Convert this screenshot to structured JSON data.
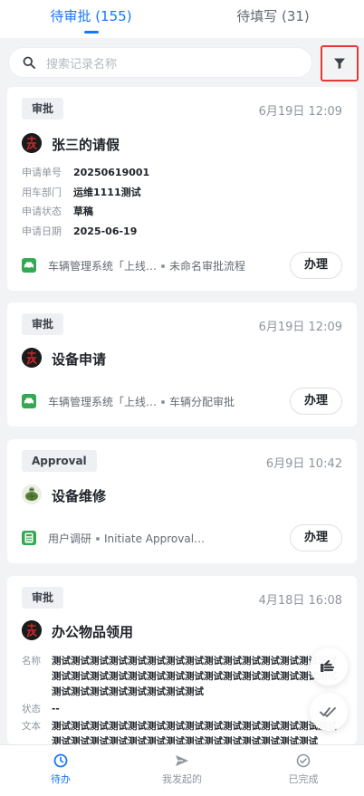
{
  "tabs": {
    "pending": "待审批 (155)",
    "to_fill": "待填写 (31)"
  },
  "search": {
    "placeholder": "搜索记录名称"
  },
  "cards": [
    {
      "badge": "审批",
      "time": "6月19日 12:09",
      "title": "张三的请假",
      "fields": [
        {
          "label": "申请单号",
          "value": "20250619001"
        },
        {
          "label": "用车部门",
          "value": "运维1111测试"
        },
        {
          "label": "申请状态",
          "value": "草稿"
        },
        {
          "label": "申请日期",
          "value": "2025-06-19"
        }
      ],
      "source": "车辆管理系统「上线…",
      "flow": "未命名审批流程",
      "action": "办理",
      "app_icon": "car-icon"
    },
    {
      "badge": "审批",
      "time": "6月19日 12:09",
      "title": "设备申请",
      "source": "车辆管理系统「上线…",
      "flow": "车辆分配审批",
      "action": "办理",
      "app_icon": "car-icon"
    },
    {
      "badge": "Approval",
      "time": "6月9日 10:42",
      "title": "设备维修",
      "source": "用户调研",
      "flow": "Initiate Approval…",
      "action": "办理",
      "app_icon": "calculator-icon"
    },
    {
      "badge": "审批",
      "time": "4月18日 16:08",
      "title": "办公物品领用",
      "fields": [
        {
          "label": "名称",
          "value": "测试测试测试测试测试测试测试测试测试测试测试测试测试测试测试测试测试测试测试测试测试测试测试测试测试测试测试测试测试测试测试测试测试测试测试测试测试测试"
        },
        {
          "label": "状态",
          "value": "--"
        },
        {
          "label": "文本",
          "value": "测试测试测试测试测试测试测试测试测试测试测试测试测试测试测试测试测试测试测试测试测试测试测试测试测试测试测试测试测试"
        }
      ]
    }
  ],
  "bottom_nav": [
    {
      "label": "待办",
      "icon": "clock-icon",
      "active": true
    },
    {
      "label": "我发起的",
      "icon": "send-icon",
      "active": false
    },
    {
      "label": "已完成",
      "icon": "check-circle-icon",
      "active": false
    }
  ],
  "colors": {
    "accent": "#1677ff",
    "app_green": "#34a853",
    "highlight_border": "#e53935"
  }
}
